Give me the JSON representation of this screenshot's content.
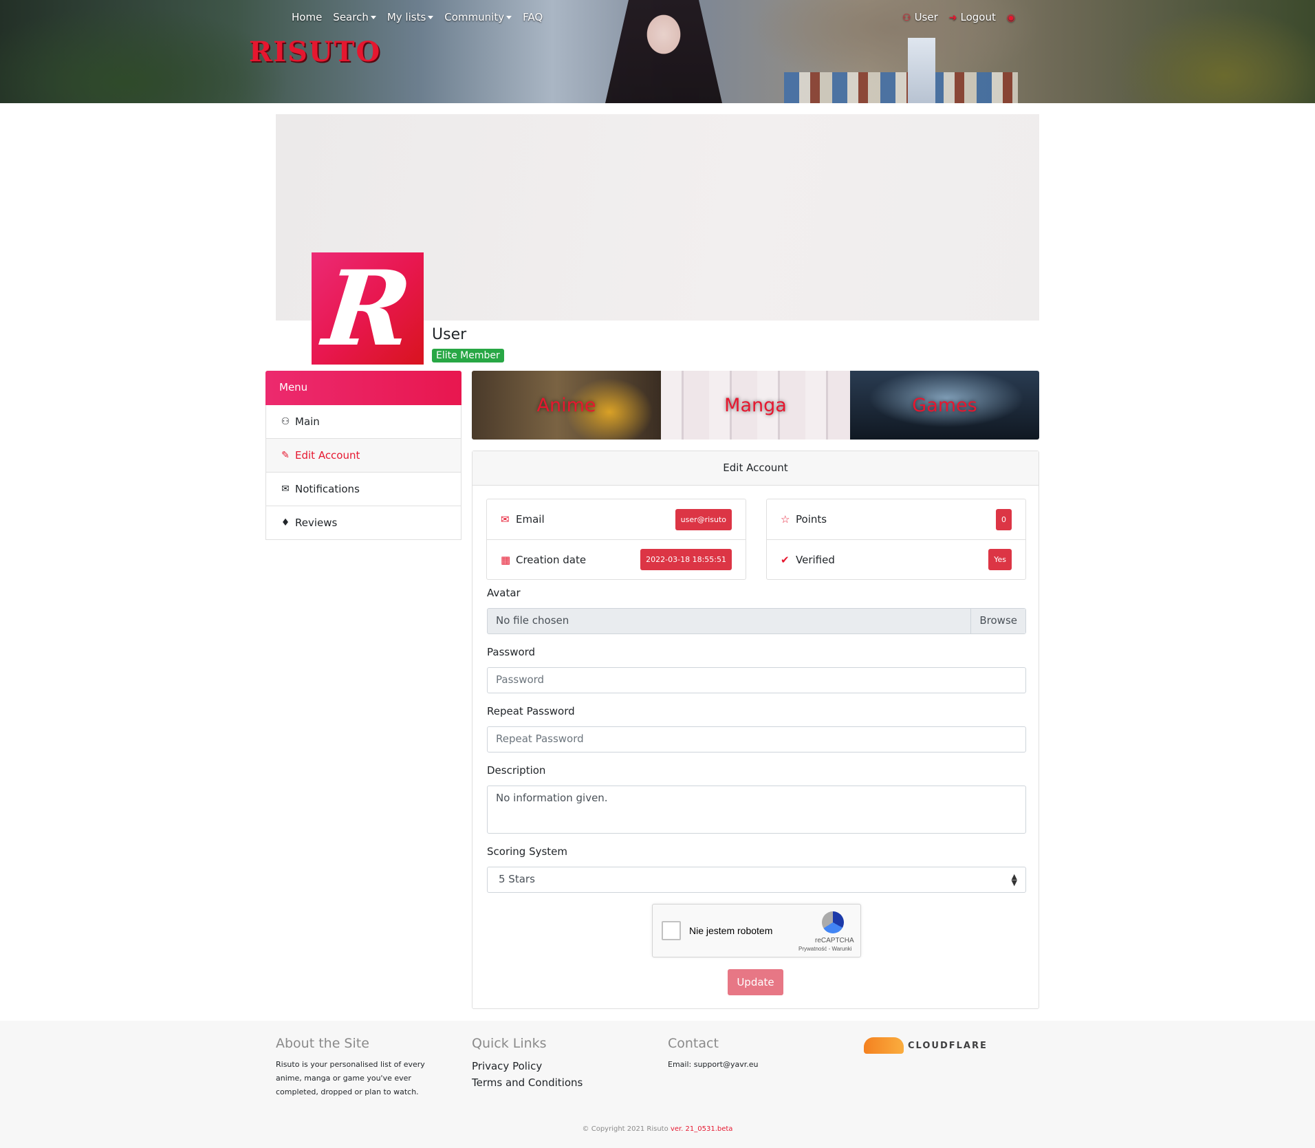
{
  "header": {
    "logo_text": "RISUTO",
    "nav": {
      "home": "Home",
      "search": "Search",
      "my_lists": "My lists",
      "community": "Community",
      "faq": "FAQ"
    },
    "user_label": "User",
    "logout_label": "Logout"
  },
  "profile": {
    "username": "User",
    "badge": "Elite Member",
    "avatar_letter": "R"
  },
  "sidebar": {
    "title": "Menu",
    "items": [
      {
        "label": "Main",
        "icon": "user-icon"
      },
      {
        "label": "Edit Account",
        "icon": "edit-icon",
        "active": true
      },
      {
        "label": "Notifications",
        "icon": "envelope-icon"
      },
      {
        "label": "Reviews",
        "icon": "bell-icon"
      }
    ]
  },
  "media": {
    "anime": "Anime",
    "manga": "Manga",
    "games": "Games"
  },
  "edit_account": {
    "title": "Edit Account",
    "email_label": "Email",
    "email_value": "user@risuto",
    "creation_label": "Creation date",
    "creation_value": "2022-03-18 18:55:51",
    "points_label": "Points",
    "points_value": "0",
    "verified_label": "Verified",
    "verified_value": "Yes",
    "avatar_label": "Avatar",
    "avatar_value": "No file chosen",
    "browse_label": "Browse",
    "password_label": "Password",
    "password_placeholder": "Password",
    "repeat_label": "Repeat Password",
    "repeat_placeholder": "Repeat Password",
    "description_label": "Description",
    "description_value": "No information given.",
    "scoring_label": "Scoring System",
    "scoring_value": "5 Stars",
    "captcha_text": "Nie jestem robotem",
    "captcha_brand": "reCAPTCHA",
    "captcha_terms": "Prywatność - Warunki",
    "update_label": "Update"
  },
  "footer": {
    "about_title": "About the Site",
    "about_text": "Risuto is your personalised list of every anime, manga or game you've ever completed, dropped or plan to watch.",
    "links_title": "Quick Links",
    "privacy": "Privacy Policy",
    "terms": "Terms and Conditions",
    "contact_title": "Contact",
    "contact_text": "Email: support@yavr.eu",
    "cloudflare": "CLOUDFLARE",
    "copyright": "© Copyright 2021 Risuto",
    "version": "ver. 21_0531.beta"
  },
  "colors": {
    "accent": "#e6172f",
    "badge_green": "#28a745",
    "update_button": "#e77785"
  }
}
